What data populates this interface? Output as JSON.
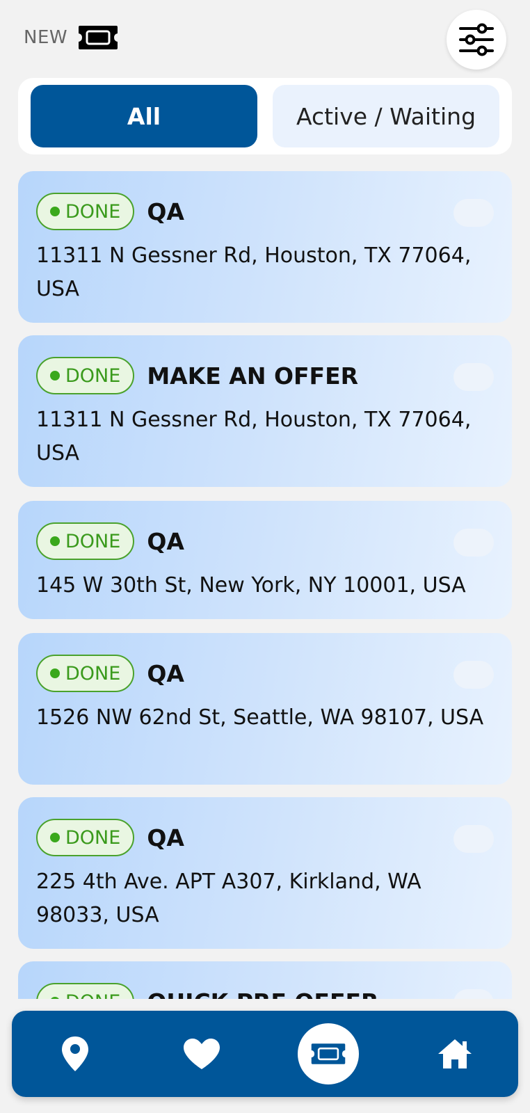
{
  "header": {
    "new_label": "NEW",
    "new_icon": "ticket-icon",
    "filter_icon": "sliders-icon"
  },
  "tabs": [
    {
      "label": "All",
      "active": true
    },
    {
      "label": "Active / Waiting",
      "active": false
    }
  ],
  "cards": [
    {
      "status": "DONE",
      "title": "QA",
      "address": "11311 N Gessner Rd, Houston, TX 77064, USA"
    },
    {
      "status": "DONE",
      "title": "MAKE AN OFFER",
      "address": "11311 N Gessner Rd, Houston, TX 77064, USA"
    },
    {
      "status": "DONE",
      "title": "QA",
      "address": "145 W 30th St, New York, NY 10001, USA"
    },
    {
      "status": "DONE",
      "title": "QA",
      "address": "1526 NW 62nd St, Seattle, WA 98107, USA"
    },
    {
      "status": "DONE",
      "title": "QA",
      "address": "225 4th Ave. APT A307, Kirkland, WA 98033, USA"
    },
    {
      "status": "DONE",
      "title": "QUICK PRE OFFER",
      "address": ""
    }
  ],
  "bottom_nav": [
    {
      "icon": "map-pin-icon",
      "active": false
    },
    {
      "icon": "heart-icon",
      "active": false
    },
    {
      "icon": "ticket-icon",
      "active": true
    },
    {
      "icon": "home-icon",
      "active": false
    }
  ],
  "colors": {
    "primary": "#005699",
    "status_green": "#3a9a1c",
    "background": "#f2f2f2"
  }
}
